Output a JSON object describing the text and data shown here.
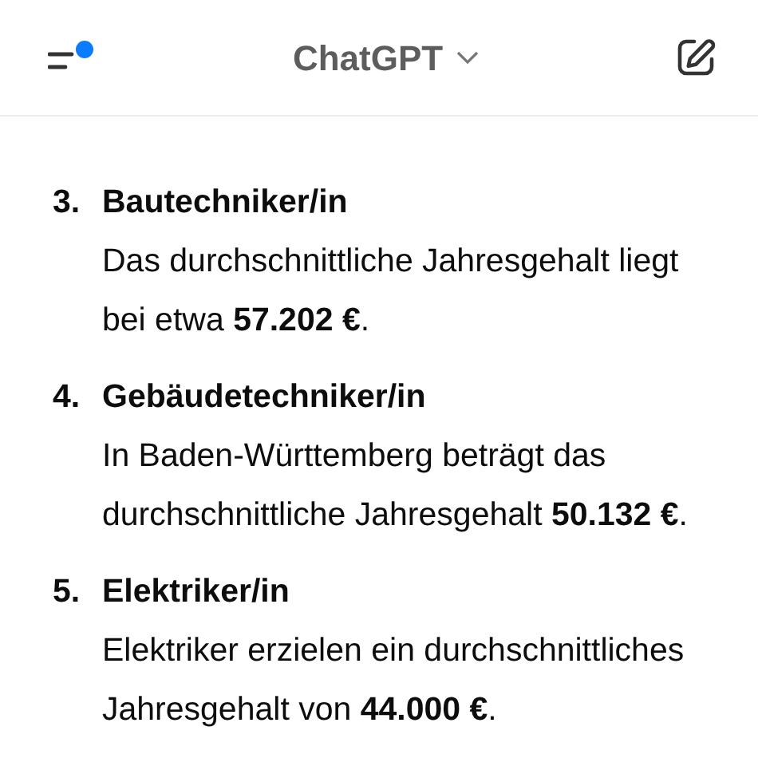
{
  "header": {
    "title": "ChatGPT",
    "notification_dot": true
  },
  "message": {
    "items": [
      {
        "number": "3.",
        "title": "Bautechniker/in",
        "text": "Das durchschnittliche Jahresgehalt liegt bei etwa **57.202 €**."
      },
      {
        "number": "4.",
        "title": "Gebäudetechniker/in",
        "text": "In Baden-Württemberg beträgt das durchschnittliche Jahresgehalt **50.132 €**."
      },
      {
        "number": "5.",
        "title": "Elektriker/in",
        "text": "Elektriker erzielen ein durchschnittliches Jahresgehalt von **44.000 €**."
      }
    ]
  }
}
